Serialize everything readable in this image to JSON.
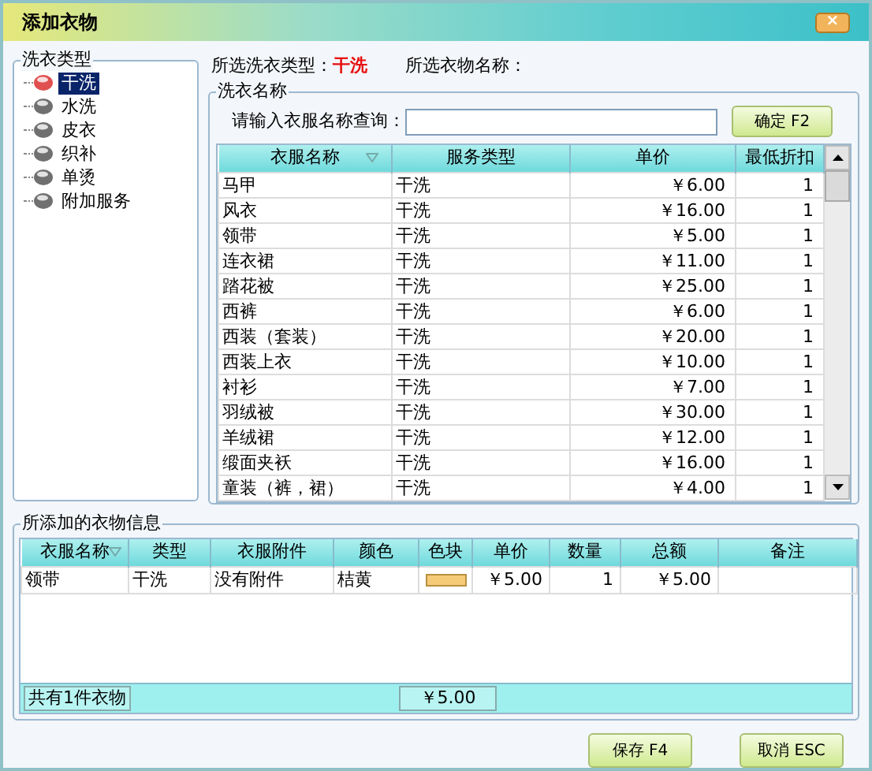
{
  "window": {
    "title": "添加衣物",
    "close": "×"
  },
  "wash_types": {
    "title": "洗衣类型",
    "items": [
      {
        "label": "干洗",
        "selected": true
      },
      {
        "label": "水洗",
        "selected": false
      },
      {
        "label": "皮衣",
        "selected": false
      },
      {
        "label": "织补",
        "selected": false
      },
      {
        "label": "单烫",
        "selected": false
      },
      {
        "label": "附加服务",
        "selected": false
      }
    ]
  },
  "selected_type": {
    "label": "所选洗衣类型：",
    "value": "干洗"
  },
  "selected_name": {
    "label": "所选衣物名称："
  },
  "garment_names": {
    "title": "洗衣名称",
    "search_label": "请输入衣服名称查询：",
    "confirm_button": "确定 F2",
    "columns": [
      "衣服名称",
      "服务类型",
      "单价",
      "最低折扣"
    ],
    "rows": [
      [
        "马甲",
        "干洗",
        "￥6.00",
        "1"
      ],
      [
        "风衣",
        "干洗",
        "￥16.00",
        "1"
      ],
      [
        "领带",
        "干洗",
        "￥5.00",
        "1"
      ],
      [
        "连衣裙",
        "干洗",
        "￥11.00",
        "1"
      ],
      [
        "踏花被",
        "干洗",
        "￥25.00",
        "1"
      ],
      [
        "西裤",
        "干洗",
        "￥6.00",
        "1"
      ],
      [
        "西装（套装）",
        "干洗",
        "￥20.00",
        "1"
      ],
      [
        "西装上衣",
        "干洗",
        "￥10.00",
        "1"
      ],
      [
        "衬衫",
        "干洗",
        "￥7.00",
        "1"
      ],
      [
        "羽绒被",
        "干洗",
        "￥30.00",
        "1"
      ],
      [
        "羊绒裙",
        "干洗",
        "￥12.00",
        "1"
      ],
      [
        "缎面夹袄",
        "干洗",
        "￥16.00",
        "1"
      ],
      [
        "童装（裤，裙）",
        "干洗",
        "￥4.00",
        "1"
      ]
    ]
  },
  "added_items": {
    "title": "所添加的衣物信息",
    "columns": [
      "衣服名称",
      "类型",
      "衣服附件",
      "颜色",
      "色块",
      "单价",
      "数量",
      "总额",
      "备注"
    ],
    "rows": [
      {
        "name": "领带",
        "type": "干洗",
        "attachment": "没有附件",
        "color_name": "桔黄",
        "color": "#f6cb78",
        "price": "￥5.00",
        "quantity": "1",
        "total": "￥5.00"
      }
    ],
    "summary": "共有1件衣物",
    "summary_total": "￥5.00"
  },
  "buttons": {
    "save": "保存 F4",
    "cancel": "取消 ESC"
  }
}
